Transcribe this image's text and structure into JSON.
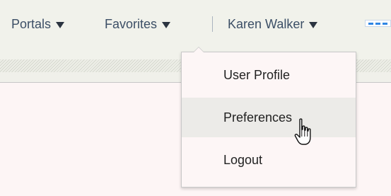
{
  "nav": {
    "portals_label": "Portals",
    "favorites_label": "Favorites",
    "user_label": "Karen Walker"
  },
  "menu": {
    "items": [
      {
        "label": "User Profile"
      },
      {
        "label": "Preferences"
      },
      {
        "label": "Logout"
      }
    ],
    "hovered_item": "Preferences"
  },
  "icons": {
    "nav_caret": "caret-down-icon",
    "overflow": "more-icon",
    "pointer": "hand-pointer-icon"
  },
  "colors": {
    "nav_text": "#3c4f66",
    "more_icon_accent": "#2f86e4",
    "menu_hover_bg": "#ecebe8"
  }
}
